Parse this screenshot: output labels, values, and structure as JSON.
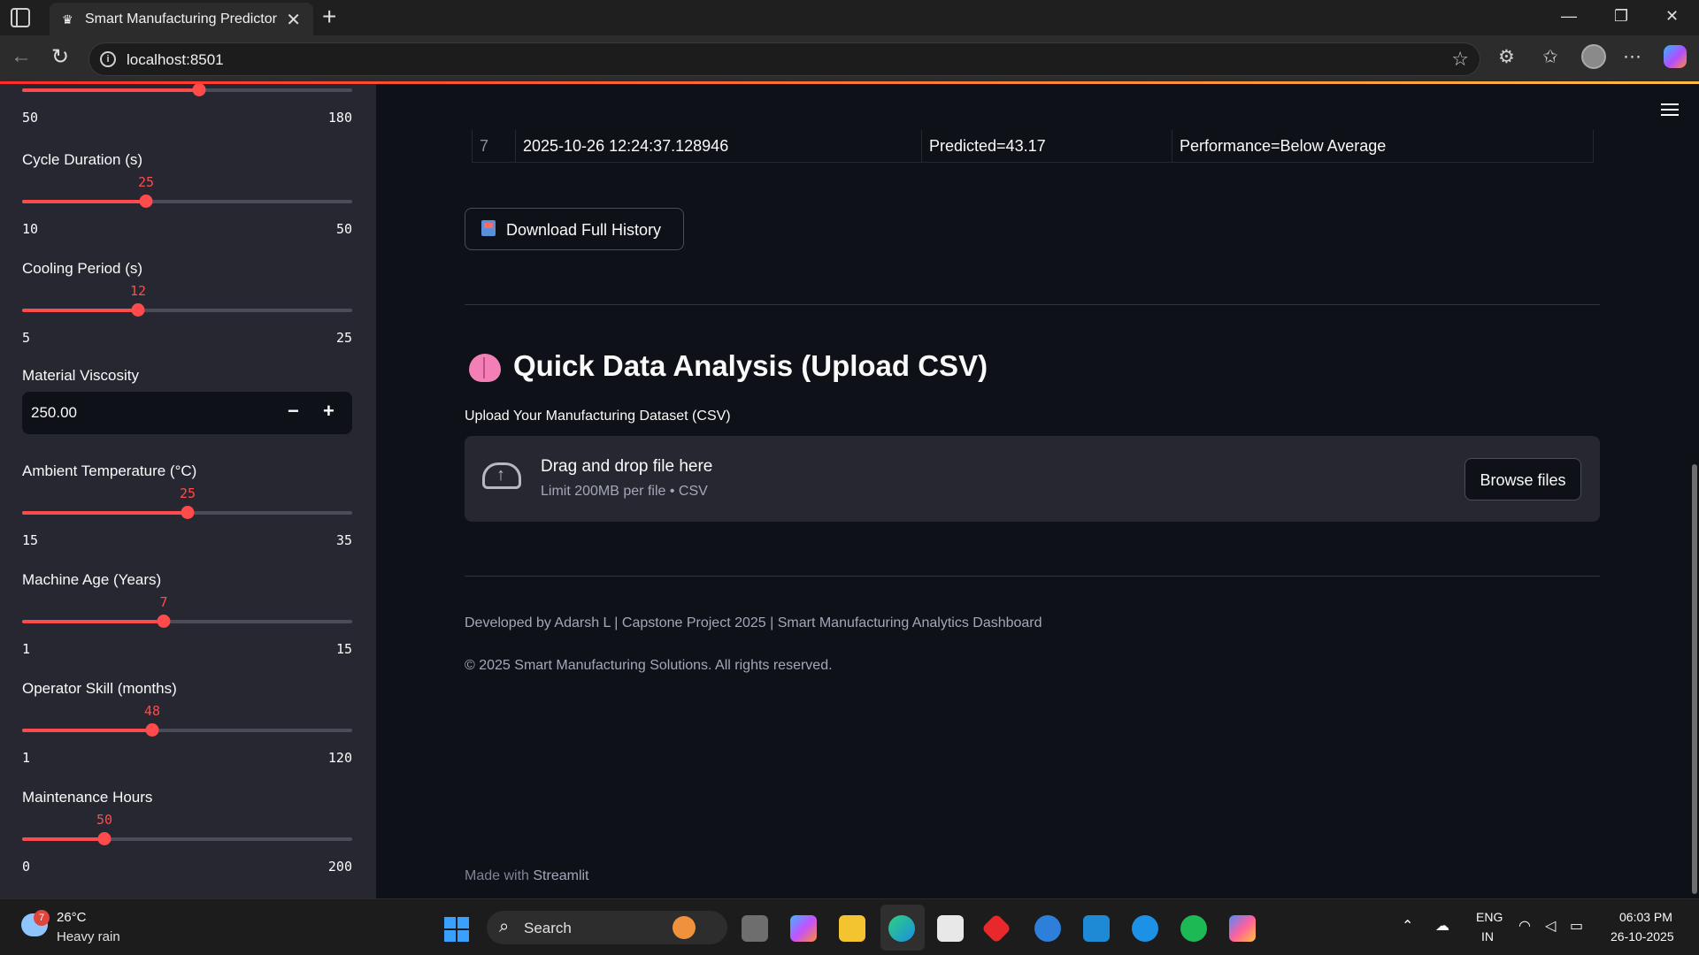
{
  "browser": {
    "tab_title": "Smart Manufacturing Predictor",
    "url": "localhost:8501"
  },
  "sidebar": {
    "top_slider": {
      "min": "50",
      "max": "180",
      "fraction": 0.535
    },
    "sliders": [
      {
        "label": "Cycle Duration (s)",
        "value": "25",
        "min": "10",
        "max": "50",
        "fraction": 0.375
      },
      {
        "label": "Cooling Period (s)",
        "value": "12",
        "min": "5",
        "max": "25",
        "fraction": 0.35
      },
      {
        "label": "Ambient Temperature (°C)",
        "value": "25",
        "min": "15",
        "max": "35",
        "fraction": 0.5
      },
      {
        "label": "Machine Age (Years)",
        "value": "7",
        "min": "1",
        "max": "15",
        "fraction": 0.4286
      },
      {
        "label": "Operator Skill (months)",
        "value": "48",
        "min": "1",
        "max": "120",
        "fraction": 0.395
      },
      {
        "label": "Maintenance Hours",
        "value": "50",
        "min": "0",
        "max": "200",
        "fraction": 0.25
      }
    ],
    "number_input": {
      "label": "Material Viscosity",
      "value": "250.00",
      "minus": "−",
      "plus": "+"
    }
  },
  "main": {
    "history_row": {
      "index": "7",
      "timestamp": "2025-10-26 12:24:37.128946",
      "prediction": "Predicted=43.17",
      "performance": "Performance=Below Average"
    },
    "download_button": "Download Full History",
    "section_title": "Quick Data Analysis (Upload CSV)",
    "upload_label": "Upload Your Manufacturing Dataset (CSV)",
    "dropzone": {
      "title": "Drag and drop file here",
      "subtitle": "Limit 200MB per file • CSV",
      "browse": "Browse files"
    },
    "footer_1": "Developed by Adarsh L | Capstone Project 2025 | Smart Manufacturing Analytics Dashboard",
    "footer_2": "© 2025 Smart Manufacturing Solutions. All rights reserved.",
    "made_with": "Made with",
    "made_with_brand": "Streamlit"
  },
  "taskbar": {
    "weather_badge": "7",
    "weather_temp": "26°C",
    "weather_desc": "Heavy rain",
    "search": "Search",
    "lang_1": "ENG",
    "lang_2": "IN",
    "time": "06:03 PM",
    "date": "26-10-2025"
  },
  "icons": {
    "menu": "hamburger-icon",
    "cloud": "cloud-upload-icon",
    "brain": "brain-icon",
    "inbox": "inbox-tray-icon"
  }
}
